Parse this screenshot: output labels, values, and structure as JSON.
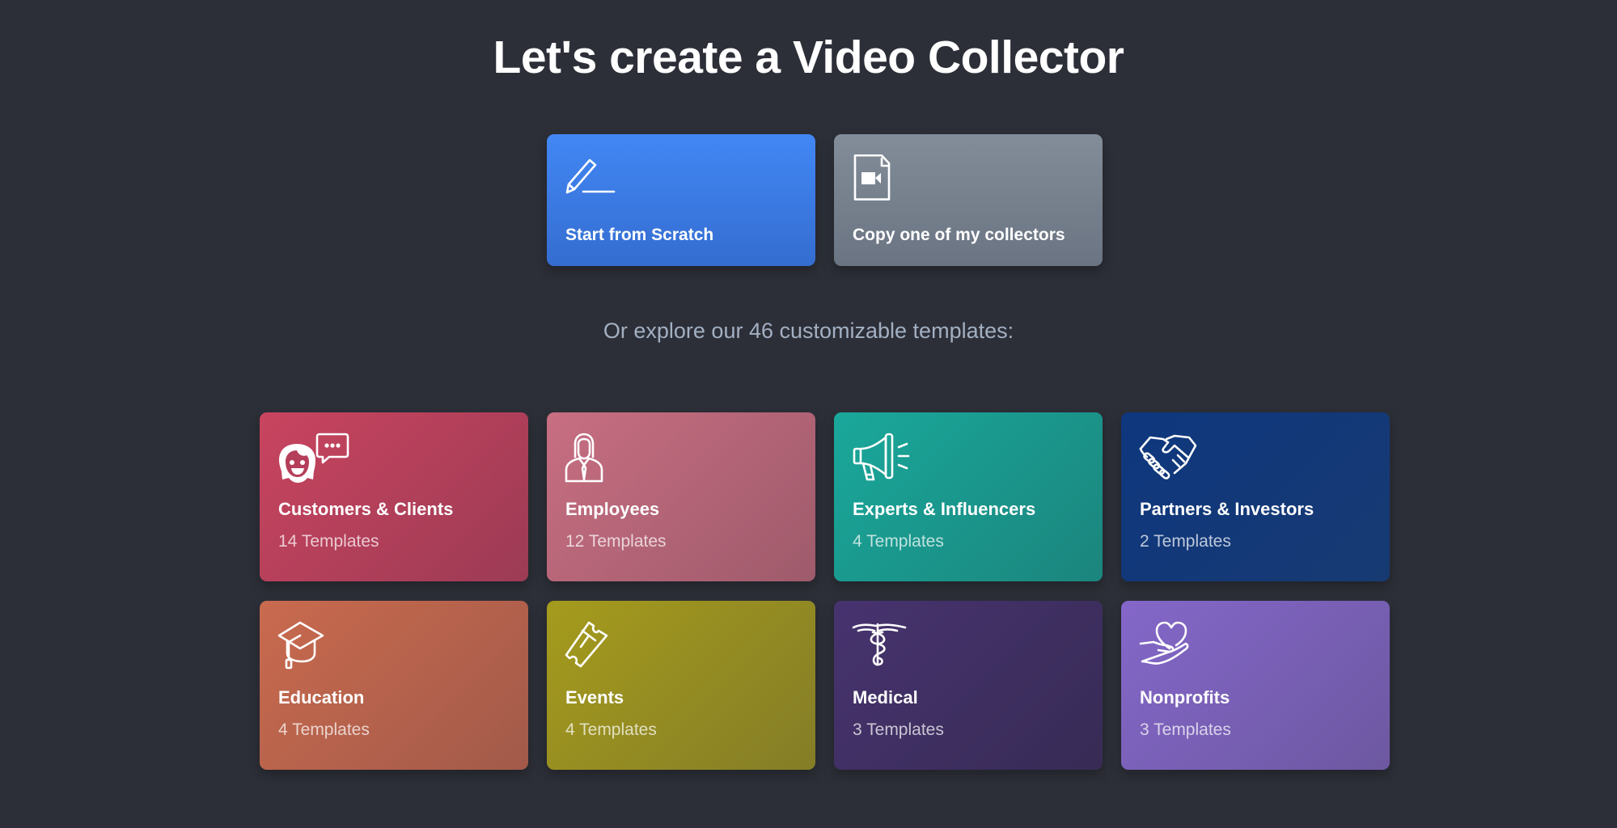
{
  "header": {
    "title": "Let's create a Video Collector"
  },
  "start_options": [
    {
      "id": "scratch",
      "label": "Start from Scratch",
      "icon": "pencil-icon",
      "color": "#3b7ae6"
    },
    {
      "id": "copy",
      "label": "Copy one of my collectors",
      "icon": "video-file-icon",
      "color": "#78828f"
    }
  ],
  "explore": {
    "text": "Or explore our 46 customizable templates:",
    "total_templates": 46
  },
  "templates": [
    {
      "name": "Customers & Clients",
      "count": "14 Templates",
      "icon": "customer-chat-icon",
      "color": "#b53f5a"
    },
    {
      "name": "Employees",
      "count": "12 Templates",
      "icon": "employee-icon",
      "color": "#b56576"
    },
    {
      "name": "Experts & Influencers",
      "count": "4 Templates",
      "icon": "megaphone-icon",
      "color": "#1a978c"
    },
    {
      "name": "Partners & Investors",
      "count": "2 Templates",
      "icon": "handshake-icon",
      "color": "#13387a"
    },
    {
      "name": "Education",
      "count": "4 Templates",
      "icon": "graduation-cap-icon",
      "color": "#b8634c"
    },
    {
      "name": "Events",
      "count": "4 Templates",
      "icon": "ticket-icon",
      "color": "#958c22"
    },
    {
      "name": "Medical",
      "count": "3 Templates",
      "icon": "caduceus-icon",
      "color": "#3f2f62"
    },
    {
      "name": "Nonprofits",
      "count": "3 Templates",
      "icon": "heart-hand-icon",
      "color": "#785fb5"
    }
  ]
}
